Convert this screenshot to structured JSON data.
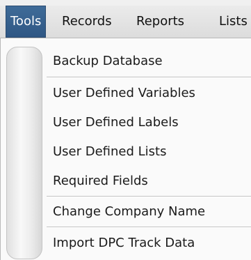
{
  "menubar": {
    "items": [
      {
        "label": "Tools",
        "active": true
      },
      {
        "label": "Records",
        "active": false
      },
      {
        "label": "Reports",
        "active": false
      },
      {
        "label": "Lists",
        "active": false
      }
    ]
  },
  "tools_menu": {
    "items": [
      {
        "label": "Backup Database"
      },
      {
        "label": "User Defined Variables"
      },
      {
        "label": "User Defined Labels"
      },
      {
        "label": "User Defined Lists"
      },
      {
        "label": "Required Fields"
      },
      {
        "label": "Change Company Name"
      },
      {
        "label": "Import DPC Track Data"
      }
    ]
  },
  "colors": {
    "active_menu_bg": "#3f6b98",
    "active_menu_text": "#ffffff",
    "menu_bg": "#fafafa"
  }
}
